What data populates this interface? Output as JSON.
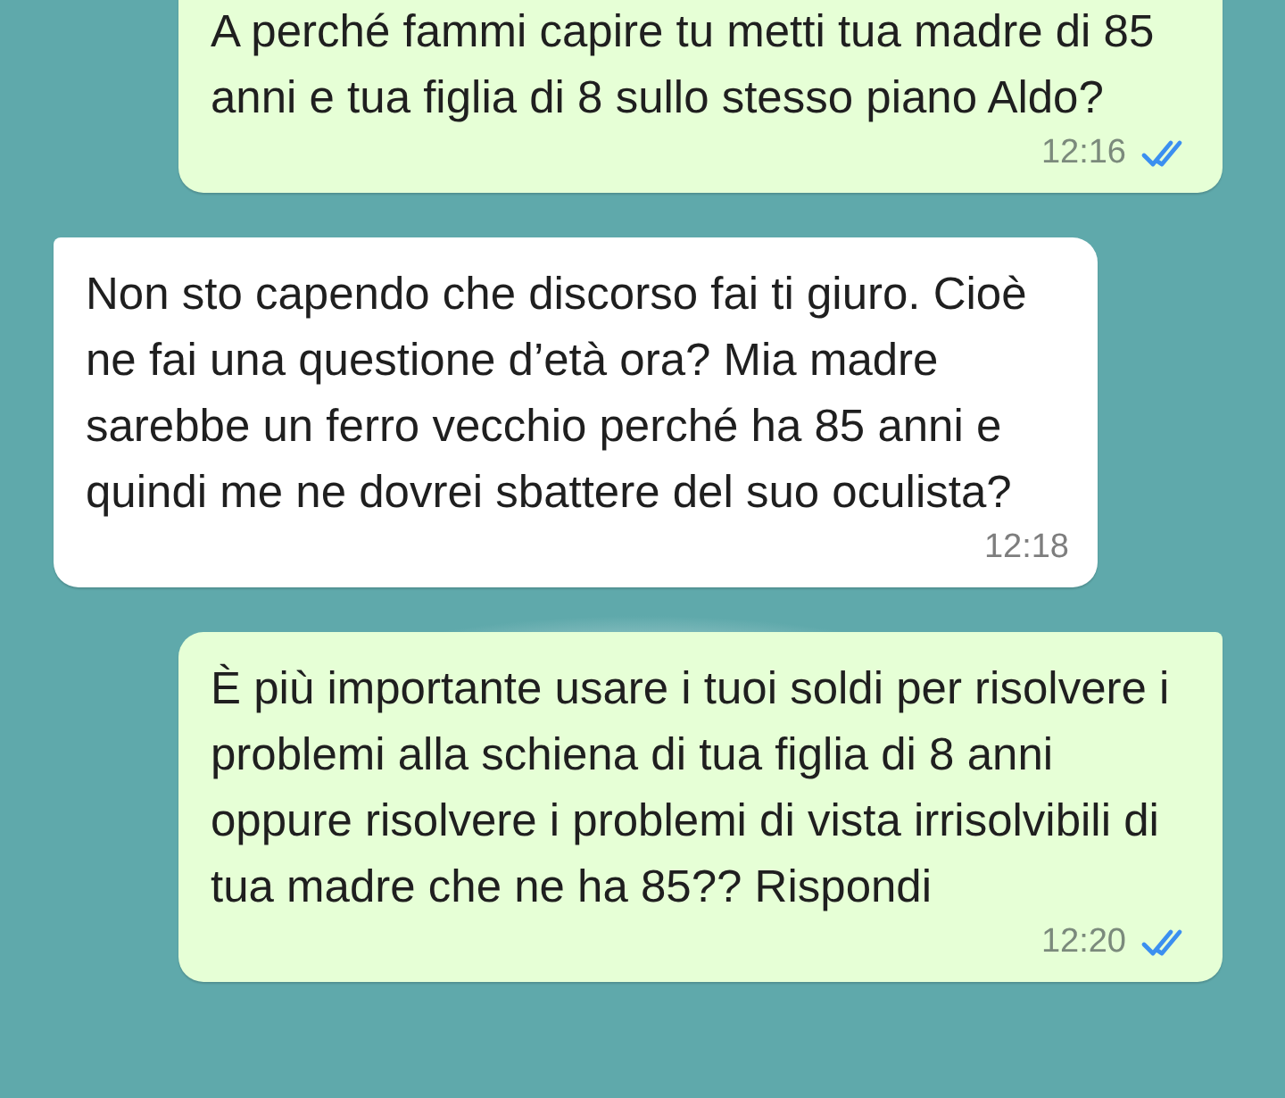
{
  "messages": [
    {
      "kind": "sent",
      "text": "A perché fammi capire tu metti tua madre di 85 anni e tua figlia di 8 sullo stesso piano Aldo?",
      "time": "12:16",
      "read": true
    },
    {
      "kind": "received",
      "text": "Non sto capendo che discorso fai ti giuro. Cioè ne fai una questione d’età ora? Mia madre sarebbe un ferro vecchio perché ha 85 anni e quindi me ne dovrei sbattere del suo oculista?",
      "time": "12:18"
    },
    {
      "kind": "sent",
      "text": "È più importante usare i tuoi soldi per risolvere i problemi alla schiena di tua figlia di 8 anni oppure risolvere i problemi di vista irrisolvibili di tua madre che ne ha 85?? Rispondi",
      "time": "12:20",
      "read": true
    }
  ]
}
